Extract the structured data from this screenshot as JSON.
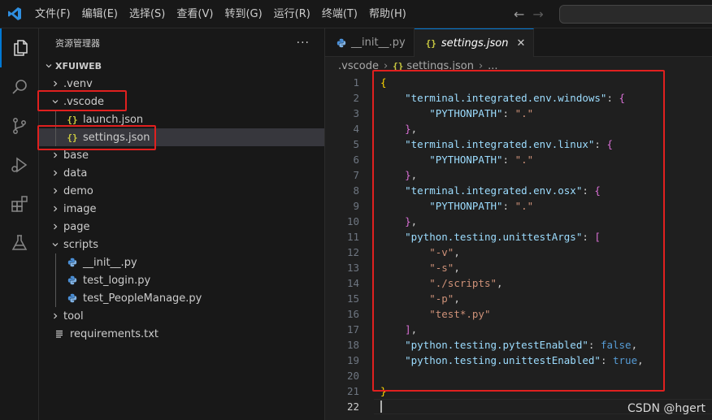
{
  "menu": [
    "文件(F)",
    "编辑(E)",
    "选择(S)",
    "查看(V)",
    "转到(G)",
    "运行(R)",
    "终端(T)",
    "帮助(H)"
  ],
  "icons": {
    "app": "vscode-logo-icon",
    "back": "arrow-left-icon",
    "forward": "arrow-right-icon",
    "explorer": "files-icon",
    "search": "search-icon",
    "scm": "source-control-icon",
    "debug": "run-debug-icon",
    "extensions": "extensions-icon",
    "testing": "beaker-icon"
  },
  "colors": {
    "accent": "#0078d4",
    "annotation": "#e0201f"
  },
  "sidebar": {
    "title": "资源管理器",
    "more": "···",
    "project": "XFUIWEB",
    "tree": [
      {
        "label": ".venv",
        "type": "folder",
        "expanded": false,
        "depth": 0
      },
      {
        "label": ".vscode",
        "type": "folder",
        "expanded": true,
        "depth": 0
      },
      {
        "label": "launch.json",
        "type": "json",
        "depth": 1
      },
      {
        "label": "settings.json",
        "type": "json",
        "depth": 1,
        "selected": true
      },
      {
        "label": "base",
        "type": "folder",
        "expanded": false,
        "depth": 0
      },
      {
        "label": "data",
        "type": "folder",
        "expanded": false,
        "depth": 0
      },
      {
        "label": "demo",
        "type": "folder",
        "expanded": false,
        "depth": 0
      },
      {
        "label": "image",
        "type": "folder",
        "expanded": false,
        "depth": 0
      },
      {
        "label": "page",
        "type": "folder",
        "expanded": false,
        "depth": 0
      },
      {
        "label": "scripts",
        "type": "folder",
        "expanded": true,
        "depth": 0
      },
      {
        "label": "__init__.py",
        "type": "python",
        "depth": 1
      },
      {
        "label": "test_login.py",
        "type": "python",
        "depth": 1
      },
      {
        "label": "test_PeopleManage.py",
        "type": "python",
        "depth": 1
      },
      {
        "label": "tool",
        "type": "folder",
        "expanded": false,
        "depth": 0
      },
      {
        "label": "requirements.txt",
        "type": "text",
        "depth": 0
      }
    ]
  },
  "editor": {
    "tabs": [
      {
        "label": "__init__.py",
        "icon": "python-file-icon",
        "active": false
      },
      {
        "label": "settings.json",
        "icon": "json-file-icon",
        "active": true,
        "close": "✕"
      }
    ],
    "breadcrumb": [
      ".vscode",
      "settings.json",
      "..."
    ],
    "current_line": 22,
    "lines": [
      {
        "n": "1",
        "t": [
          [
            "b1",
            "{"
          ]
        ]
      },
      {
        "n": "2",
        "t": [
          [
            "sp",
            "    "
          ],
          [
            "key",
            "\"terminal.integrated.env.windows\""
          ],
          [
            "p",
            ": "
          ],
          [
            "b2",
            "{"
          ]
        ]
      },
      {
        "n": "3",
        "t": [
          [
            "sp",
            "        "
          ],
          [
            "key",
            "\"PYTHONPATH\""
          ],
          [
            "p",
            ": "
          ],
          [
            "str",
            "\".\""
          ]
        ]
      },
      {
        "n": "4",
        "t": [
          [
            "sp",
            "    "
          ],
          [
            "b2",
            "}"
          ],
          [
            "p",
            ","
          ]
        ]
      },
      {
        "n": "5",
        "t": [
          [
            "sp",
            "    "
          ],
          [
            "key",
            "\"terminal.integrated.env.linux\""
          ],
          [
            "p",
            ": "
          ],
          [
            "b2",
            "{"
          ]
        ]
      },
      {
        "n": "6",
        "t": [
          [
            "sp",
            "        "
          ],
          [
            "key",
            "\"PYTHONPATH\""
          ],
          [
            "p",
            ": "
          ],
          [
            "str",
            "\".\""
          ]
        ]
      },
      {
        "n": "7",
        "t": [
          [
            "sp",
            "    "
          ],
          [
            "b2",
            "}"
          ],
          [
            "p",
            ","
          ]
        ]
      },
      {
        "n": "8",
        "t": [
          [
            "sp",
            "    "
          ],
          [
            "key",
            "\"terminal.integrated.env.osx\""
          ],
          [
            "p",
            ": "
          ],
          [
            "b2",
            "{"
          ]
        ]
      },
      {
        "n": "9",
        "t": [
          [
            "sp",
            "        "
          ],
          [
            "key",
            "\"PYTHONPATH\""
          ],
          [
            "p",
            ": "
          ],
          [
            "str",
            "\".\""
          ]
        ]
      },
      {
        "n": "10",
        "t": [
          [
            "sp",
            "    "
          ],
          [
            "b2",
            "}"
          ],
          [
            "p",
            ","
          ]
        ]
      },
      {
        "n": "11",
        "t": [
          [
            "sp",
            "    "
          ],
          [
            "key",
            "\"python.testing.unittestArgs\""
          ],
          [
            "p",
            ": "
          ],
          [
            "b2",
            "["
          ]
        ]
      },
      {
        "n": "12",
        "t": [
          [
            "sp",
            "        "
          ],
          [
            "str",
            "\"-v\""
          ],
          [
            "p",
            ","
          ]
        ]
      },
      {
        "n": "13",
        "t": [
          [
            "sp",
            "        "
          ],
          [
            "str",
            "\"-s\""
          ],
          [
            "p",
            ","
          ]
        ]
      },
      {
        "n": "14",
        "t": [
          [
            "sp",
            "        "
          ],
          [
            "str",
            "\"./scripts\""
          ],
          [
            "p",
            ","
          ]
        ]
      },
      {
        "n": "15",
        "t": [
          [
            "sp",
            "        "
          ],
          [
            "str",
            "\"-p\""
          ],
          [
            "p",
            ","
          ]
        ]
      },
      {
        "n": "16",
        "t": [
          [
            "sp",
            "        "
          ],
          [
            "str",
            "\"test*.py\""
          ]
        ]
      },
      {
        "n": "17",
        "t": [
          [
            "sp",
            "    "
          ],
          [
            "b2",
            "]"
          ],
          [
            "p",
            ","
          ]
        ]
      },
      {
        "n": "18",
        "t": [
          [
            "sp",
            "    "
          ],
          [
            "key",
            "\"python.testing.pytestEnabled\""
          ],
          [
            "p",
            ": "
          ],
          [
            "kw",
            "false"
          ],
          [
            "p",
            ","
          ]
        ]
      },
      {
        "n": "19",
        "t": [
          [
            "sp",
            "    "
          ],
          [
            "key",
            "\"python.testing.unittestEnabled\""
          ],
          [
            "p",
            ": "
          ],
          [
            "kw",
            "true"
          ],
          [
            "p",
            ","
          ]
        ]
      },
      {
        "n": "20",
        "t": []
      },
      {
        "n": "21",
        "t": [
          [
            "b1",
            "}"
          ]
        ]
      },
      {
        "n": "22",
        "t": []
      }
    ]
  },
  "watermark": "CSDN @hgert"
}
